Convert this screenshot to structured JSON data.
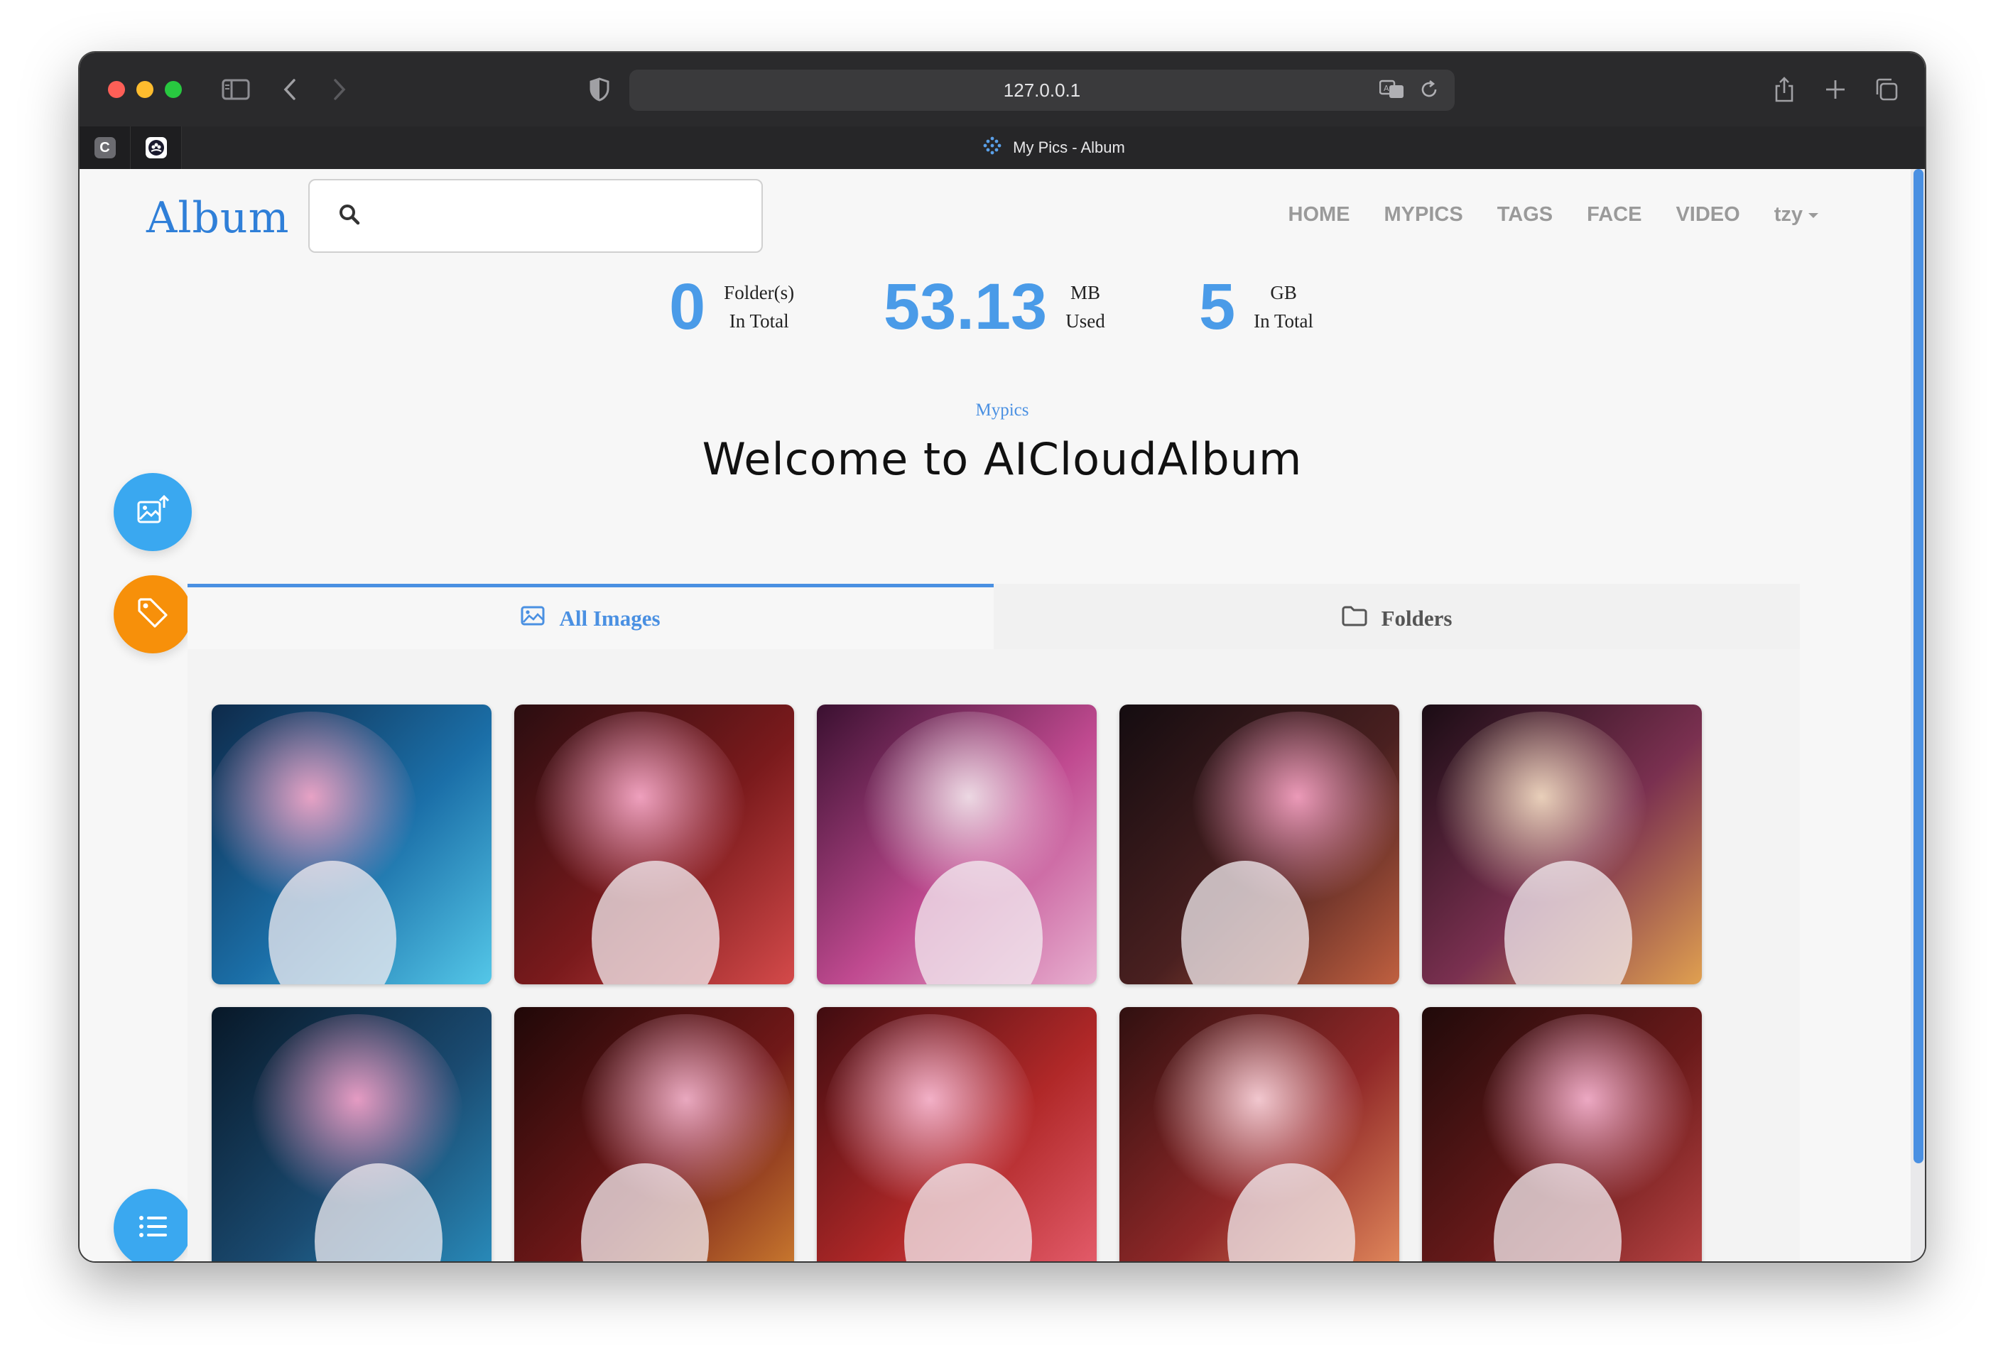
{
  "browser": {
    "url": "127.0.0.1",
    "tab_title": "My Pics - Album",
    "pinned_tabs": [
      "C",
      "pinned-app"
    ]
  },
  "app": {
    "logo": "Album",
    "search": {
      "value": "",
      "placeholder": ""
    },
    "nav": [
      "HOME",
      "MYPICS",
      "TAGS",
      "FACE",
      "VIDEO",
      "tzy"
    ]
  },
  "stats": [
    {
      "number": "0",
      "label1": "Folder(s)",
      "label2": "In Total"
    },
    {
      "number": "53.13",
      "label1": "MB",
      "label2": "Used"
    },
    {
      "number": "5",
      "label1": "GB",
      "label2": "In Total"
    }
  ],
  "hero": {
    "subtitle": "Mypics",
    "headline": "Welcome to AICloudAlbum"
  },
  "tabs": {
    "all_images": "All Images",
    "folders": "Folders",
    "active": "all_images"
  },
  "images": [
    {
      "icon": "image-thumbnail"
    },
    {
      "icon": "image-thumbnail"
    },
    {
      "icon": "image-thumbnail"
    },
    {
      "icon": "image-thumbnail"
    },
    {
      "icon": "image-thumbnail"
    },
    {
      "icon": "image-thumbnail"
    },
    {
      "icon": "image-thumbnail"
    },
    {
      "icon": "image-thumbnail"
    },
    {
      "icon": "image-thumbnail"
    },
    {
      "icon": "image-thumbnail"
    }
  ],
  "colors": {
    "accent": "#4a90e2",
    "fab_blue": "#3aa8f0",
    "fab_orange": "#f7900a"
  }
}
